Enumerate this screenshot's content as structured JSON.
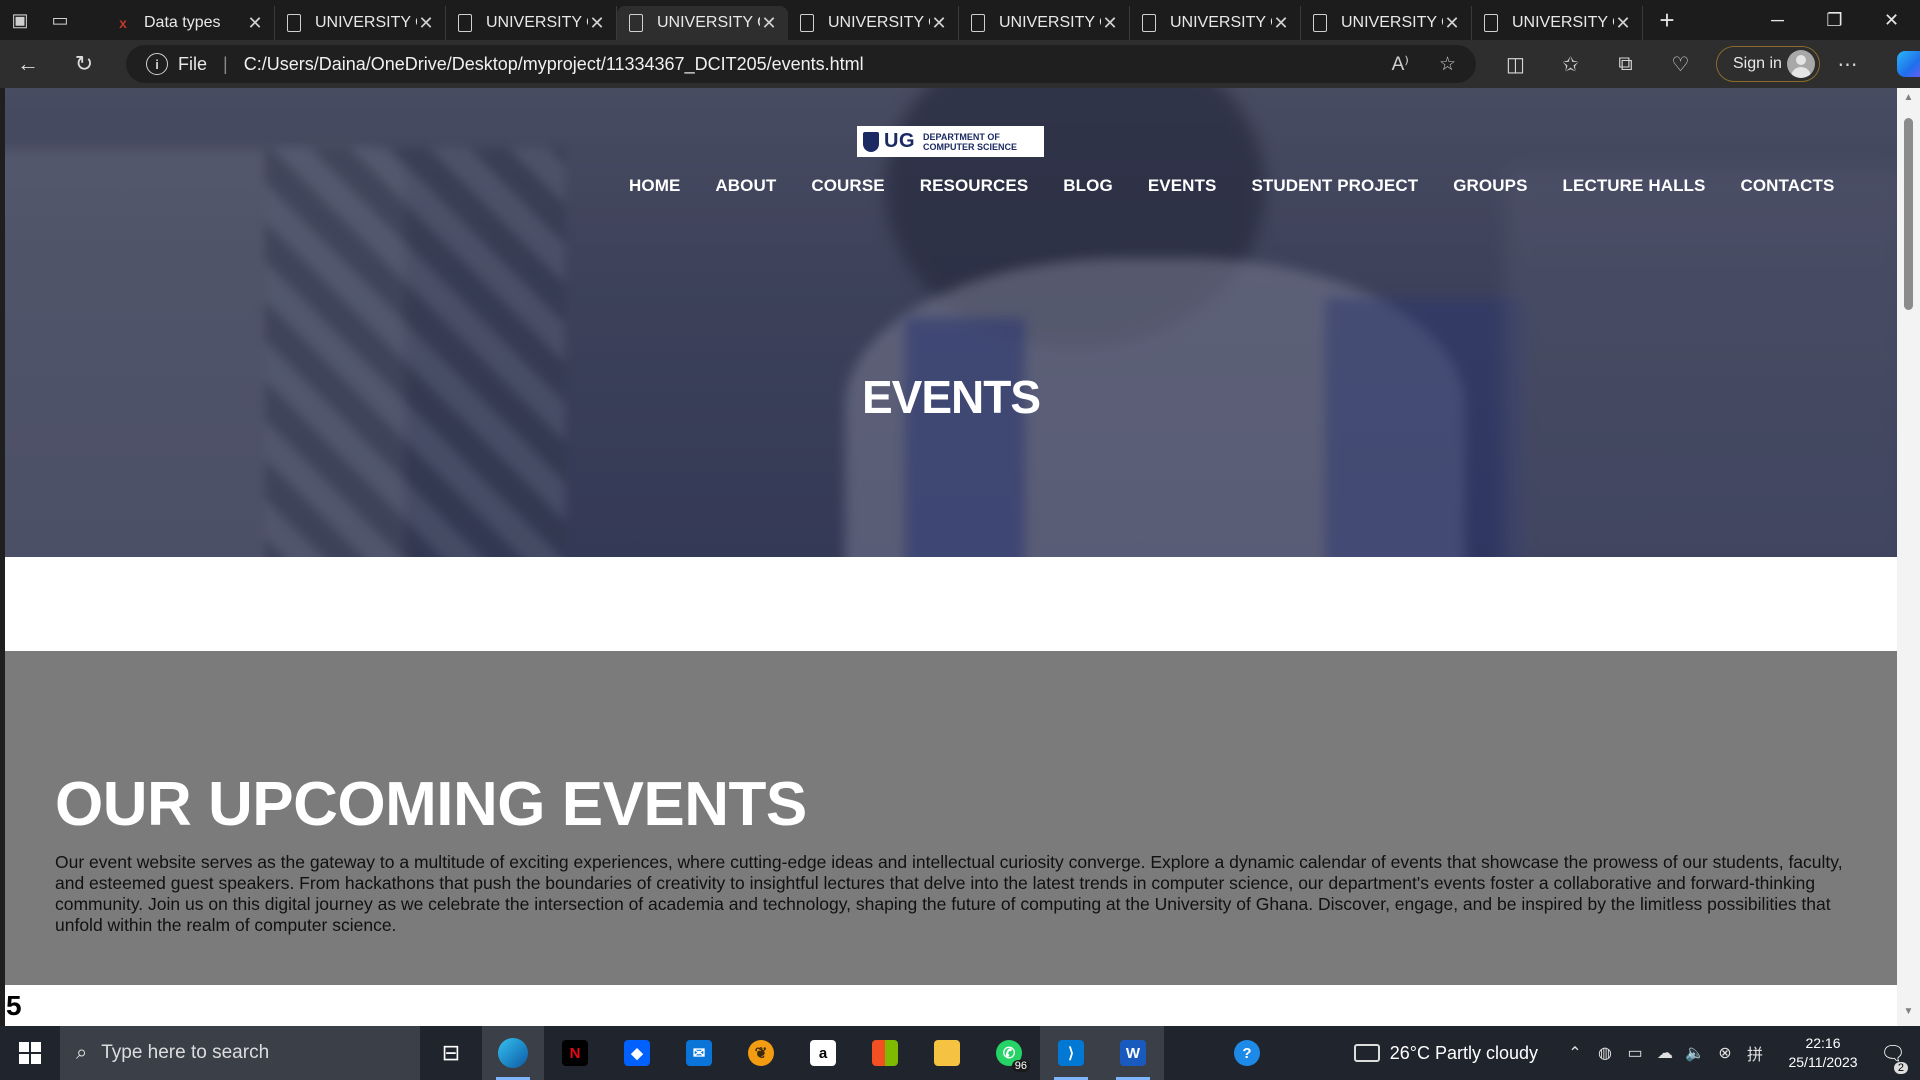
{
  "browser": {
    "tabs": [
      {
        "title": "Data types",
        "icon": "w3schools-icon",
        "active": false
      },
      {
        "title": "UNIVERSITY OF",
        "icon": "document-icon",
        "active": false
      },
      {
        "title": "UNIVERSITY OF",
        "icon": "document-icon",
        "active": false
      },
      {
        "title": "UNIVERSITY OF",
        "icon": "document-icon",
        "active": true
      },
      {
        "title": "UNIVERSITY OF",
        "icon": "document-icon",
        "active": false
      },
      {
        "title": "UNIVERSITY OF",
        "icon": "document-icon",
        "active": false
      },
      {
        "title": "UNIVERSITY OF",
        "icon": "document-icon",
        "active": false
      },
      {
        "title": "UNIVERSITY OF",
        "icon": "document-icon",
        "active": false
      },
      {
        "title": "UNIVERSITY OF",
        "icon": "document-icon",
        "active": false
      }
    ],
    "address": {
      "scheme_label": "File",
      "url": "C:/Users/Daina/OneDrive/Desktop/myproject/11334367_DCIT205/events.html"
    },
    "sign_in_label": "Sign in"
  },
  "site": {
    "logo": {
      "mark": "UG",
      "line1": "DEPARTMENT OF",
      "line2": "COMPUTER SCIENCE"
    },
    "nav": [
      "HOME",
      "ABOUT",
      "COURSE",
      "RESOURCES",
      "BLOG",
      "EVENTS",
      "STUDENT PROJECT",
      "GROUPS",
      "LECTURE HALLS",
      "CONTACTS"
    ],
    "hero_title": "EVENTS",
    "section": {
      "heading": "OUR UPCOMING EVENTS",
      "body": "Our event website serves as the gateway to a multitude of exciting experiences, where cutting-edge ideas and intellectual curiosity converge. Explore a dynamic calendar of events that showcase the prowess of our students, faculty, and esteemed guest speakers. From hackathons that push the boundaries of creativity to insightful lectures that delve into the latest trends in computer science, our department's events foster a collaborative and forward-thinking community. Join us on this digital journey as we celebrate the intersection of academia and technology, shaping the future of computing at the University of Ghana. Discover, engage, and be inspired by the limitless possibilities that unfold within the realm of computer science."
    },
    "footer_number": "5"
  },
  "taskbar": {
    "search_placeholder": "Type here to search",
    "apps": [
      {
        "name": "task-view",
        "badge": ""
      },
      {
        "name": "edge",
        "badge": ""
      },
      {
        "name": "netflix",
        "badge": ""
      },
      {
        "name": "dropbox",
        "badge": ""
      },
      {
        "name": "mail",
        "badge": ""
      },
      {
        "name": "fl-studio",
        "badge": ""
      },
      {
        "name": "amazon",
        "badge": ""
      },
      {
        "name": "microsoft-store",
        "badge": ""
      },
      {
        "name": "file-explorer",
        "badge": ""
      },
      {
        "name": "whatsapp",
        "badge": "96"
      },
      {
        "name": "vscode",
        "badge": ""
      },
      {
        "name": "word",
        "badge": ""
      },
      {
        "name": "help",
        "badge": ""
      }
    ],
    "weather": "26°C  Partly cloudy",
    "time": "22:16",
    "date": "25/11/2023",
    "notifications": "2"
  }
}
